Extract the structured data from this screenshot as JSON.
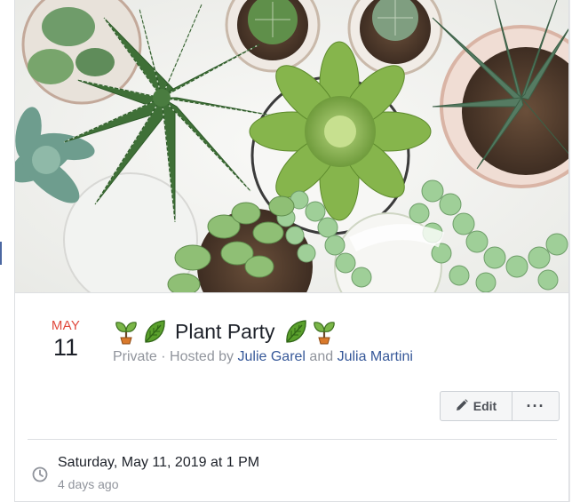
{
  "event": {
    "month": "MAY",
    "day": "11",
    "title": "Plant Party",
    "privacy": "Private",
    "separator": " · ",
    "hosted_by_prefix": "Hosted by ",
    "host_1": "Julie Garel",
    "host_joiner": " and ",
    "host_2": "Julia Martini"
  },
  "title_emojis": [
    "seedling-icon",
    "leaf-icon",
    "leaf-icon",
    "seedling-icon"
  ],
  "actions": {
    "edit_label": "Edit",
    "more_label": "···"
  },
  "details": {
    "datetime": "Saturday, May 11, 2019 at 1 PM",
    "relative": "4 days ago"
  },
  "colors": {
    "month_red": "#e0493d",
    "link_blue": "#365899",
    "muted_gray": "#90949c",
    "text_dark": "#1d2129"
  }
}
